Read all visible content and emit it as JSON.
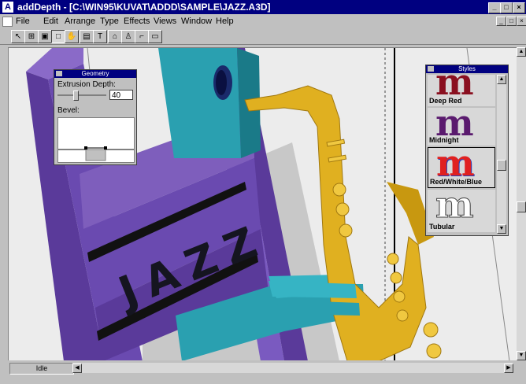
{
  "window": {
    "title": "addDepth - [C:\\WIN95\\KUVAT\\ADDD\\SAMPLE\\JAZZ.A3D]",
    "app_icon": "A",
    "min_label": "_",
    "max_label": "□",
    "close_label": "×"
  },
  "menu": [
    "File",
    "Edit",
    "Arrange",
    "Type",
    "Effects",
    "Views",
    "Window",
    "Help"
  ],
  "toolbar": {
    "tools": [
      {
        "name": "arrow-icon",
        "glyph": "↖"
      },
      {
        "name": "grid-select-icon",
        "glyph": "⊞"
      },
      {
        "name": "frame-icon",
        "glyph": "▣"
      },
      {
        "name": "rectangle-icon",
        "glyph": "□"
      },
      {
        "name": "hand-icon",
        "glyph": "✋"
      },
      {
        "name": "box-icon",
        "glyph": "▤"
      },
      {
        "name": "text-icon",
        "glyph": "T"
      },
      {
        "name": "shape-icon",
        "glyph": "⌂"
      },
      {
        "name": "lamp-icon",
        "glyph": "♙"
      },
      {
        "name": "path-icon",
        "glyph": "⌐"
      },
      {
        "name": "window-icon",
        "glyph": "▭"
      }
    ]
  },
  "geometry_palette": {
    "title": "Geometry",
    "extrusion_label": "Extrusion Depth:",
    "extrusion_value": "40",
    "bevel_label": "Bevel:"
  },
  "styles_palette": {
    "title": "Styles",
    "items": [
      {
        "label": "Deep Red",
        "glyph": "m",
        "color": "#8a1020"
      },
      {
        "label": "Midnight",
        "glyph": "m",
        "color": "#5a1a6e"
      },
      {
        "label": "Red/White/Blue",
        "glyph": "m",
        "color": "#e02020"
      },
      {
        "label": "Tubular",
        "glyph": "m",
        "color": "#ffffff"
      }
    ]
  },
  "canvas": {
    "artwork_text": "JAZZ"
  },
  "status": {
    "text": "Idle"
  },
  "colors": {
    "titlebar": "#000080",
    "purple": "#6a4aa8",
    "teal": "#2aa0b0",
    "gold": "#e0b020"
  }
}
